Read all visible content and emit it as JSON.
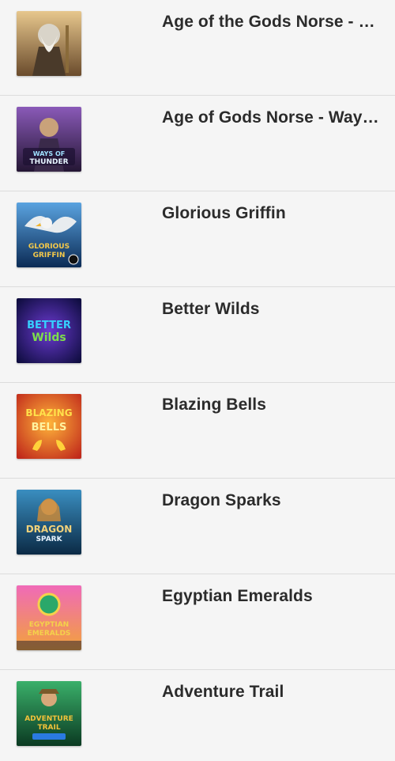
{
  "games": [
    {
      "title": "Age of the Gods Norse - Ki...",
      "thumb_label": "",
      "colors": [
        "#b98a4a",
        "#5a4a3a",
        "#e9c98a"
      ]
    },
    {
      "title": "Age of Gods Norse - Ways ...",
      "thumb_label": "WAYS OF THUNDER",
      "colors": [
        "#6b3f8a",
        "#2a1c3e",
        "#c9a0e8"
      ]
    },
    {
      "title": "Glorious Griffin",
      "thumb_label": "GLORIOUS GRIFFIN",
      "colors": [
        "#2c6fb3",
        "#0b2b55",
        "#f3c84a"
      ]
    },
    {
      "title": "Better Wilds",
      "thumb_label": "BETTER Wilds",
      "colors": [
        "#2b1a6e",
        "#0b0b3a",
        "#7ee04a"
      ]
    },
    {
      "title": "Blazing Bells",
      "thumb_label": "BLAZING BELLS",
      "colors": [
        "#f07a16",
        "#c0281b",
        "#ffd63a"
      ]
    },
    {
      "title": "Dragon Sparks",
      "thumb_label": "DRAGON SPARK",
      "colors": [
        "#1f6f9a",
        "#0b2a45",
        "#f2d27a"
      ]
    },
    {
      "title": "Egyptian Emeralds",
      "thumb_label": "EGYPTIAN EMERALDS",
      "colors": [
        "#e45aa8",
        "#2aa86a",
        "#f4d24a"
      ]
    },
    {
      "title": "Adventure Trail",
      "thumb_label": "ADVENTURE TRAIL",
      "colors": [
        "#1f8a4a",
        "#0b3a22",
        "#f2c23a"
      ]
    }
  ]
}
